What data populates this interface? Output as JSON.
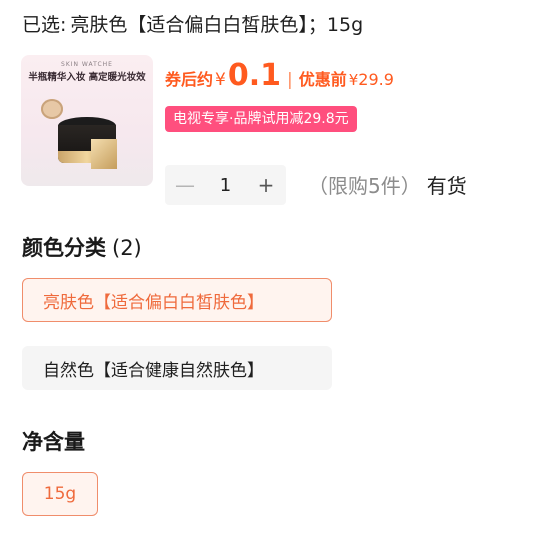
{
  "selected": {
    "label": "已选:",
    "value": "亮肤色【适合偏白白皙肤色】；15g"
  },
  "product": {
    "thumb_brand": "SKIN WATCHE",
    "thumb_headline": "半瓶精华入妆 高定暖光妆效",
    "coupon_price_label": "券后约",
    "currency": "¥",
    "coupon_price": "0.1",
    "divider": "|",
    "original_price_label": "优惠前",
    "original_price": "29.9",
    "promo_tag": "电视专享·品牌试用减29.8元",
    "accent_color": "#ff5a1f",
    "tag_color": "#ff4f7e"
  },
  "quantity": {
    "minus_icon": "minus-icon",
    "plus_icon": "plus-icon",
    "minus_symbol": "—",
    "plus_symbol": "+",
    "value": "1",
    "limit_text": "（限购5件）",
    "stock_status": "有货"
  },
  "color_section": {
    "title": "颜色分类",
    "count": "(2)",
    "options": [
      {
        "label": "亮肤色【适合偏白白皙肤色】",
        "selected": true
      },
      {
        "label": "自然色【适合健康自然肤色】",
        "selected": false
      }
    ]
  },
  "size_section": {
    "title": "净含量",
    "options": [
      {
        "label": "15g",
        "selected": true
      }
    ]
  }
}
